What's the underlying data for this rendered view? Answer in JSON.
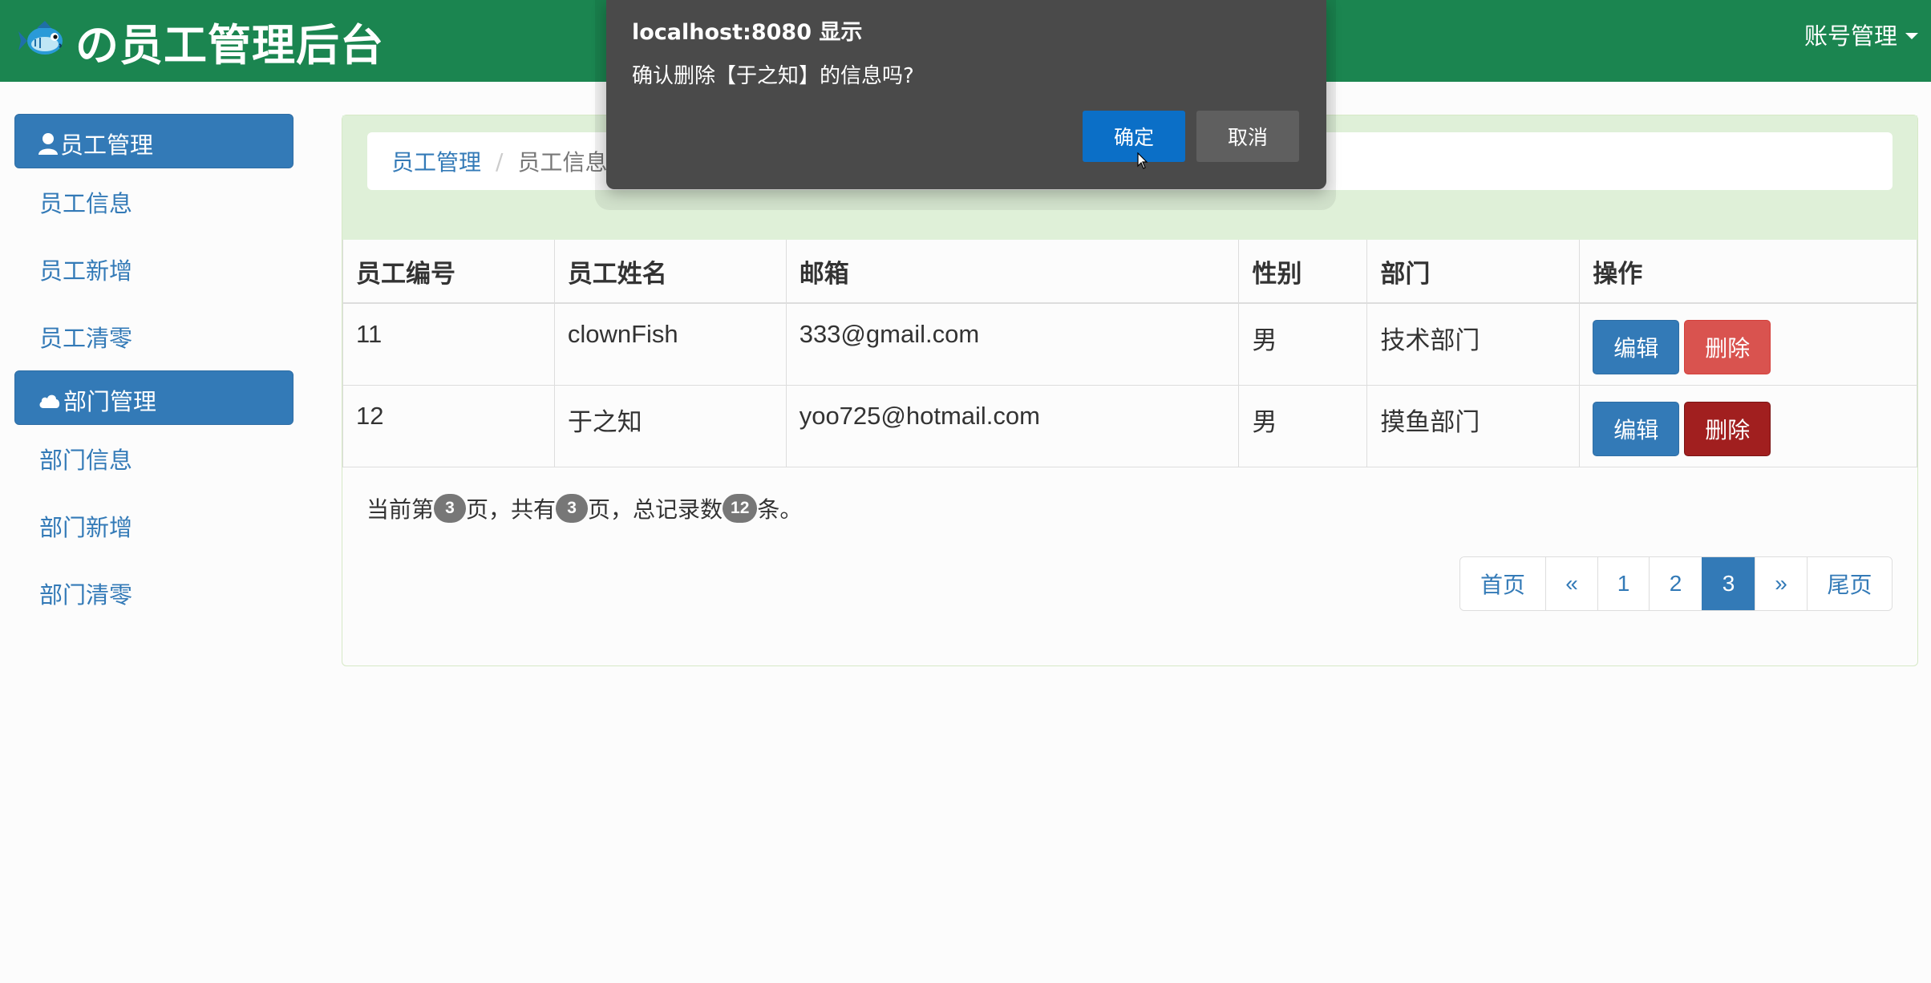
{
  "navbar": {
    "brand_title": "の员工管理后台",
    "account_menu": "账号管理"
  },
  "sidebar": {
    "groups": [
      {
        "header": "员工管理",
        "icon": "user-icon",
        "items": [
          {
            "label": "员工信息"
          },
          {
            "label": "员工新增"
          },
          {
            "label": "员工清零"
          }
        ]
      },
      {
        "header": "部门管理",
        "icon": "cloud-icon",
        "items": [
          {
            "label": "部门信息"
          },
          {
            "label": "部门新增"
          },
          {
            "label": "部门清零"
          }
        ]
      }
    ]
  },
  "breadcrumb": {
    "items": [
      "员工管理",
      "员工信息"
    ]
  },
  "table": {
    "headers": [
      "员工编号",
      "员工姓名",
      "邮箱",
      "性别",
      "部门",
      "操作"
    ],
    "rows": [
      {
        "id": "11",
        "name": "clownFish",
        "email": "333@gmail.com",
        "gender": "男",
        "dept": "技术部门"
      },
      {
        "id": "12",
        "name": "于之知",
        "email": "yoo725@hotmail.com",
        "gender": "男",
        "dept": "摸鱼部门"
      }
    ],
    "edit_label": "编辑",
    "delete_label": "删除"
  },
  "page_info": {
    "prefix": "当前第",
    "current_page": "3",
    "mid1": "页，共有",
    "total_pages": "3",
    "mid2": "页，总记录数",
    "total_records": "12",
    "suffix": "条。"
  },
  "pagination": {
    "first": "首页",
    "prev": "«",
    "pages": [
      "1",
      "2",
      "3"
    ],
    "active_page": "3",
    "next": "»",
    "last": "尾页"
  },
  "dialog": {
    "title": "localhost:8080 显示",
    "message": "确认删除【于之知】的信息吗?",
    "ok_label": "确定",
    "cancel_label": "取消"
  },
  "colors": {
    "navbar": "#1b8550",
    "primary": "#337ab7",
    "danger": "#d9534f",
    "panel_header": "#dff0d8",
    "dialog_bg": "#4a4a4a",
    "dialog_ok": "#0b6fc7"
  }
}
